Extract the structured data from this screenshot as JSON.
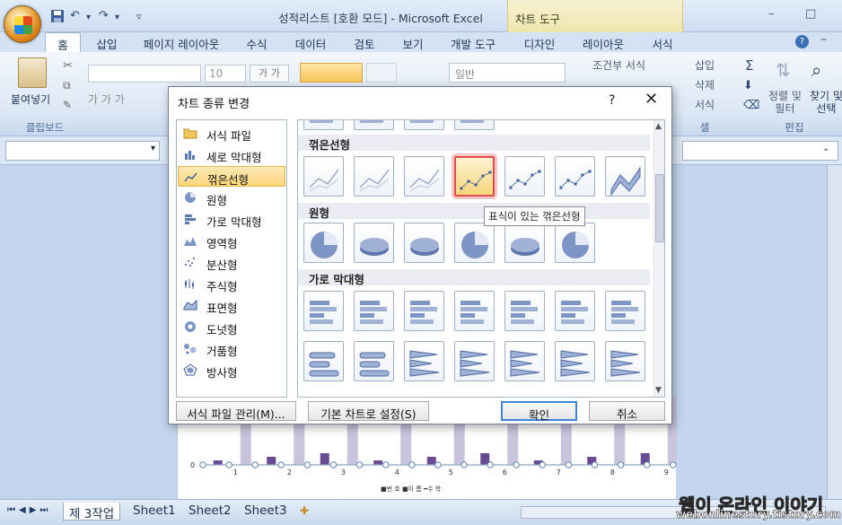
{
  "title_bar": {
    "app_title": "성적리스트 [호환 모드] - Microsoft Excel",
    "tools_title": "차트 도구",
    "minimize": "–",
    "restore": "□"
  },
  "ribbon_tabs": [
    "홈",
    "삽입",
    "페이지 레이아웃",
    "수식",
    "데이터",
    "검토",
    "보기",
    "개발 도구",
    "디자인",
    "레이아웃",
    "서식"
  ],
  "ribbon": {
    "paste_label": "붙여넣기",
    "clipboard_group": "클립보드",
    "font_name": "",
    "font_size": "10",
    "number_format": "일반",
    "conditional_format": "조건부 서식",
    "insert": "삽입",
    "delete": "삭제",
    "format": "서식",
    "cells_group": "셀",
    "sort_filter": "정렬 및\n필터",
    "find_select": "찾기 및\n선택",
    "editing_group": "편집"
  },
  "dialog": {
    "title": "차트 종류 변경",
    "help": "?",
    "close": "✕",
    "categories": [
      {
        "label": "서식 파일",
        "icon": "folder-icon"
      },
      {
        "label": "세로 막대형",
        "icon": "column-chart-icon"
      },
      {
        "label": "꺾은선형",
        "icon": "line-chart-icon"
      },
      {
        "label": "원형",
        "icon": "pie-chart-icon"
      },
      {
        "label": "가로 막대형",
        "icon": "bar-chart-icon"
      },
      {
        "label": "영역형",
        "icon": "area-chart-icon"
      },
      {
        "label": "분산형",
        "icon": "scatter-chart-icon"
      },
      {
        "label": "주식형",
        "icon": "stock-chart-icon"
      },
      {
        "label": "표면형",
        "icon": "surface-chart-icon"
      },
      {
        "label": "도넛형",
        "icon": "doughnut-chart-icon"
      },
      {
        "label": "거품형",
        "icon": "bubble-chart-icon"
      },
      {
        "label": "방사형",
        "icon": "radar-chart-icon"
      }
    ],
    "selected_category": "꺾은선형",
    "sections": [
      "꺾은선형",
      "원형",
      "가로 막대형"
    ],
    "tooltip": "표식이 있는 꺾은선형",
    "manage_templates": "서식 파일 관리(M)...",
    "set_default": "기본 차트로 설정(S)",
    "ok": "확인",
    "cancel": "취소"
  },
  "chart_background": {
    "x_ticks": [
      "1",
      "2",
      "3",
      "4",
      "5",
      "6",
      "7",
      "8",
      "9"
    ],
    "y_tick": "0",
    "legend": "■번 호 ■이 름 ━수 학"
  },
  "sheet_tabs": [
    "제 3작업",
    "Sheet1",
    "Sheet2",
    "Sheet3"
  ],
  "watermark": {
    "line1": "웹이 온라인 이야기",
    "line2": "webonlinestory.tistory.com"
  }
}
